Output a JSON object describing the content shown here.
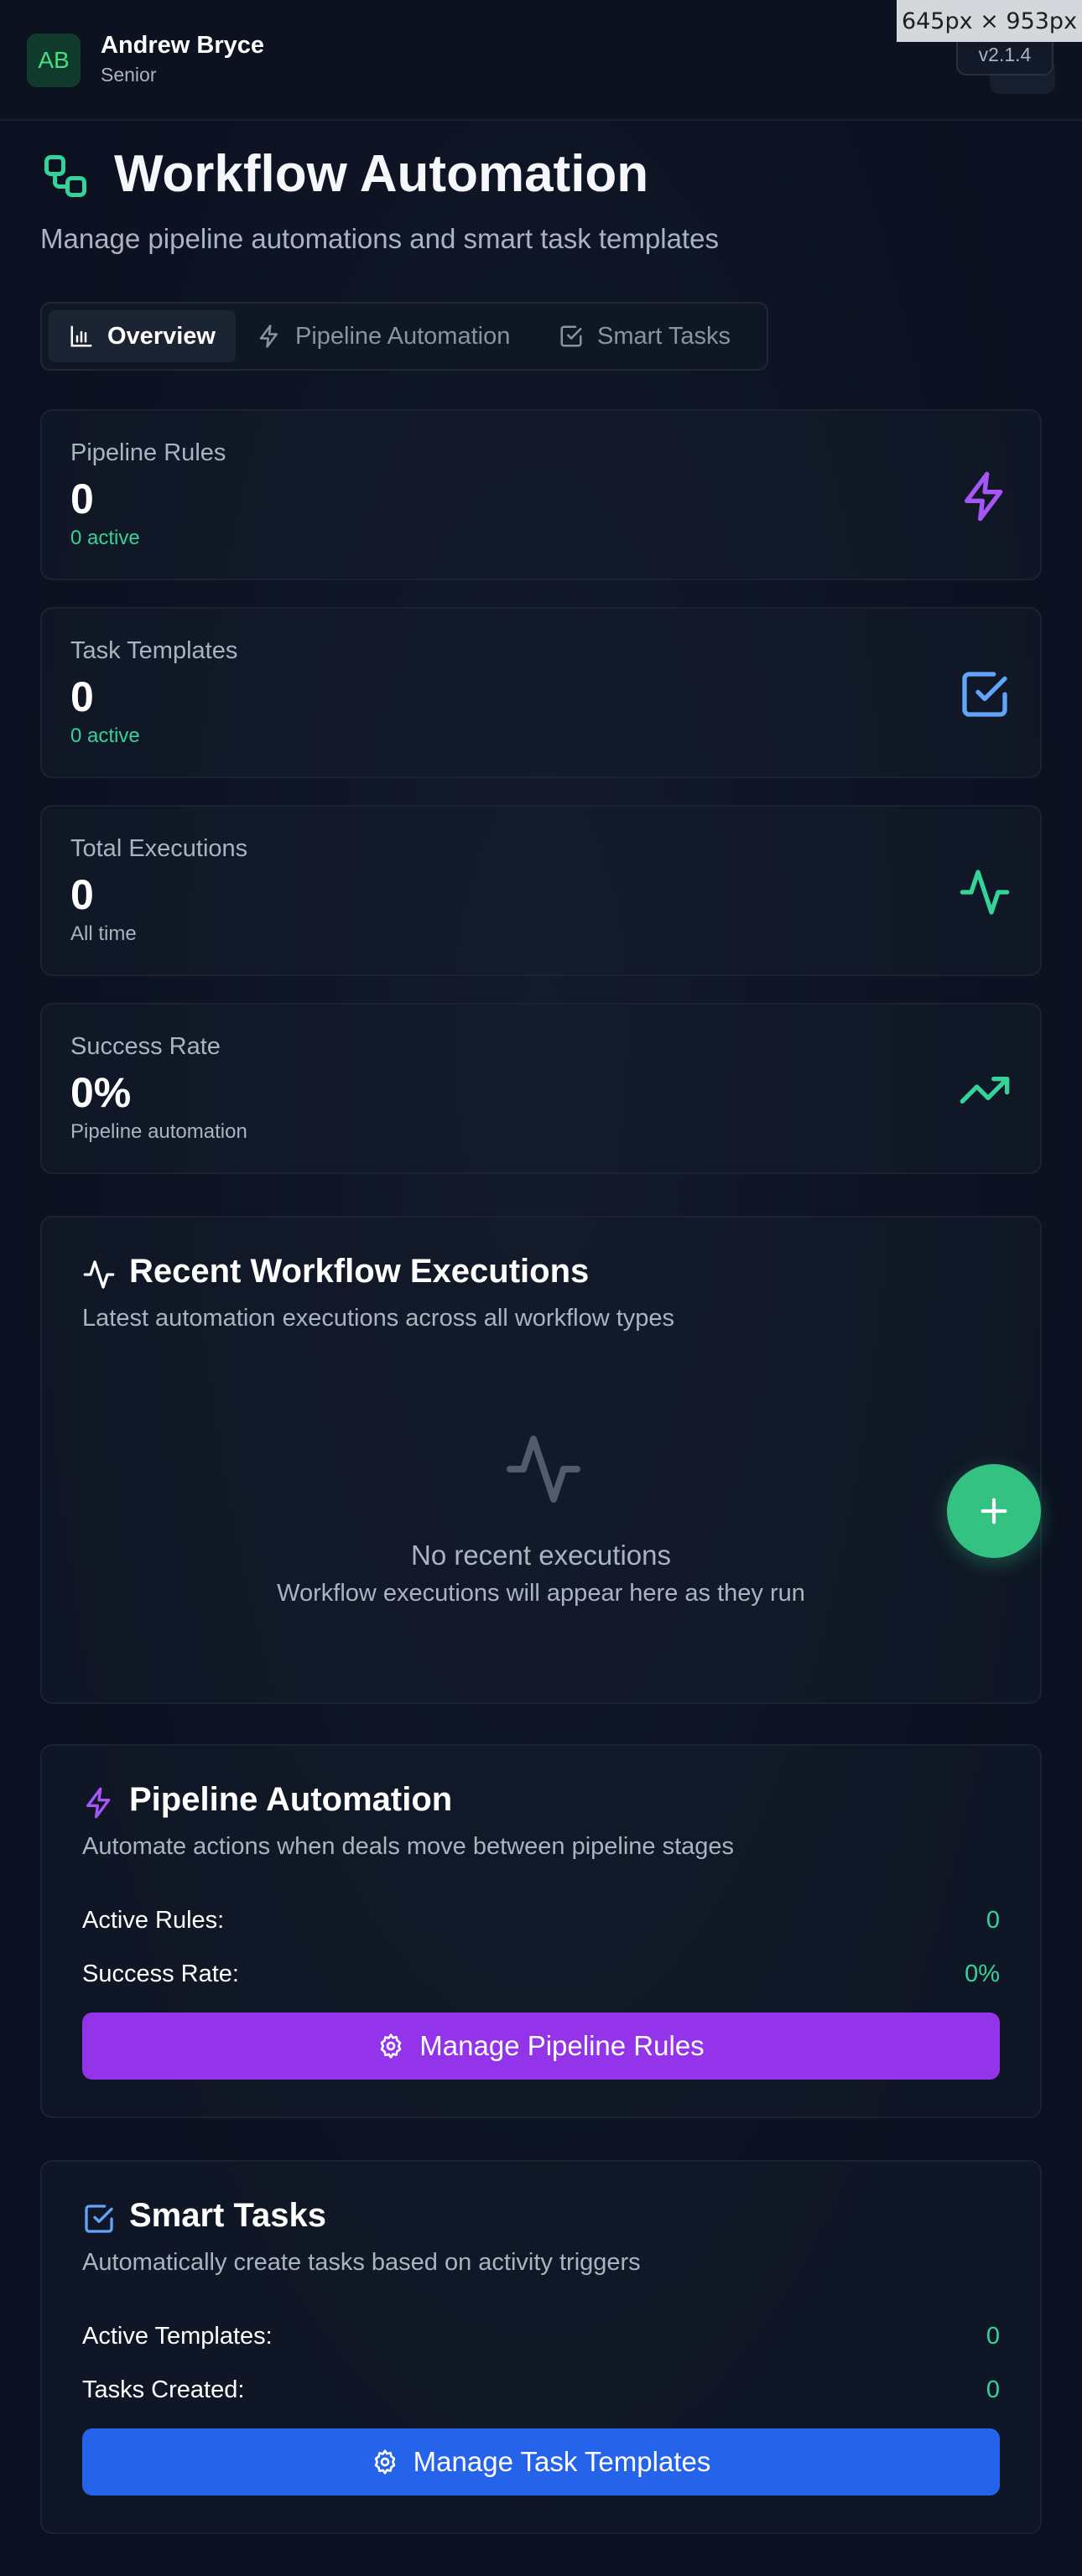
{
  "user": {
    "initials": "AB",
    "name": "Andrew Bryce",
    "role": "Senior"
  },
  "overlay": {
    "dimensions_label": "645px × 953px"
  },
  "app": {
    "version": "v2.1.4"
  },
  "page": {
    "title": "Workflow Automation",
    "subtitle": "Manage pipeline automations and smart task templates"
  },
  "tabs": [
    {
      "label": "Overview",
      "icon": "bar-chart-icon",
      "active": true
    },
    {
      "label": "Pipeline Automation",
      "icon": "lightning-icon",
      "active": false
    },
    {
      "label": "Smart Tasks",
      "icon": "checkbox-icon",
      "active": false
    }
  ],
  "stats": [
    {
      "label": "Pipeline Rules",
      "value": "0",
      "sub": "0 active",
      "icon": "lightning-icon",
      "icon_color": "#a855f7"
    },
    {
      "label": "Task Templates",
      "value": "0",
      "sub": "0 active",
      "icon": "checkbox-icon",
      "icon_color": "#60a5fa"
    },
    {
      "label": "Total Executions",
      "value": "0",
      "sub": "All time",
      "icon": "activity-icon",
      "icon_color": "#34d399"
    },
    {
      "label": "Success Rate",
      "value": "0%",
      "sub": "Pipeline automation",
      "icon": "trending-up-icon",
      "icon_color": "#34d399"
    }
  ],
  "recent": {
    "title": "Recent Workflow Executions",
    "description": "Latest automation executions across all workflow types",
    "empty_title": "No recent executions",
    "empty_description": "Workflow executions will appear here as they run"
  },
  "pipeline_automation": {
    "title": "Pipeline Automation",
    "description": "Automate actions when deals move between pipeline stages",
    "active_rules_label": "Active Rules:",
    "active_rules_value": "0",
    "success_rate_label": "Success Rate:",
    "success_rate_value": "0%",
    "button_label": "Manage Pipeline Rules"
  },
  "smart_tasks": {
    "title": "Smart Tasks",
    "description": "Automatically create tasks based on activity triggers",
    "active_templates_label": "Active Templates:",
    "active_templates_value": "0",
    "tasks_created_label": "Tasks Created:",
    "tasks_created_value": "0",
    "button_label": "Manage Task Templates"
  },
  "colors": {
    "accent_green": "#34d399",
    "purple": "#9333ea",
    "blue": "#2563eb",
    "background": "#0b1120"
  }
}
